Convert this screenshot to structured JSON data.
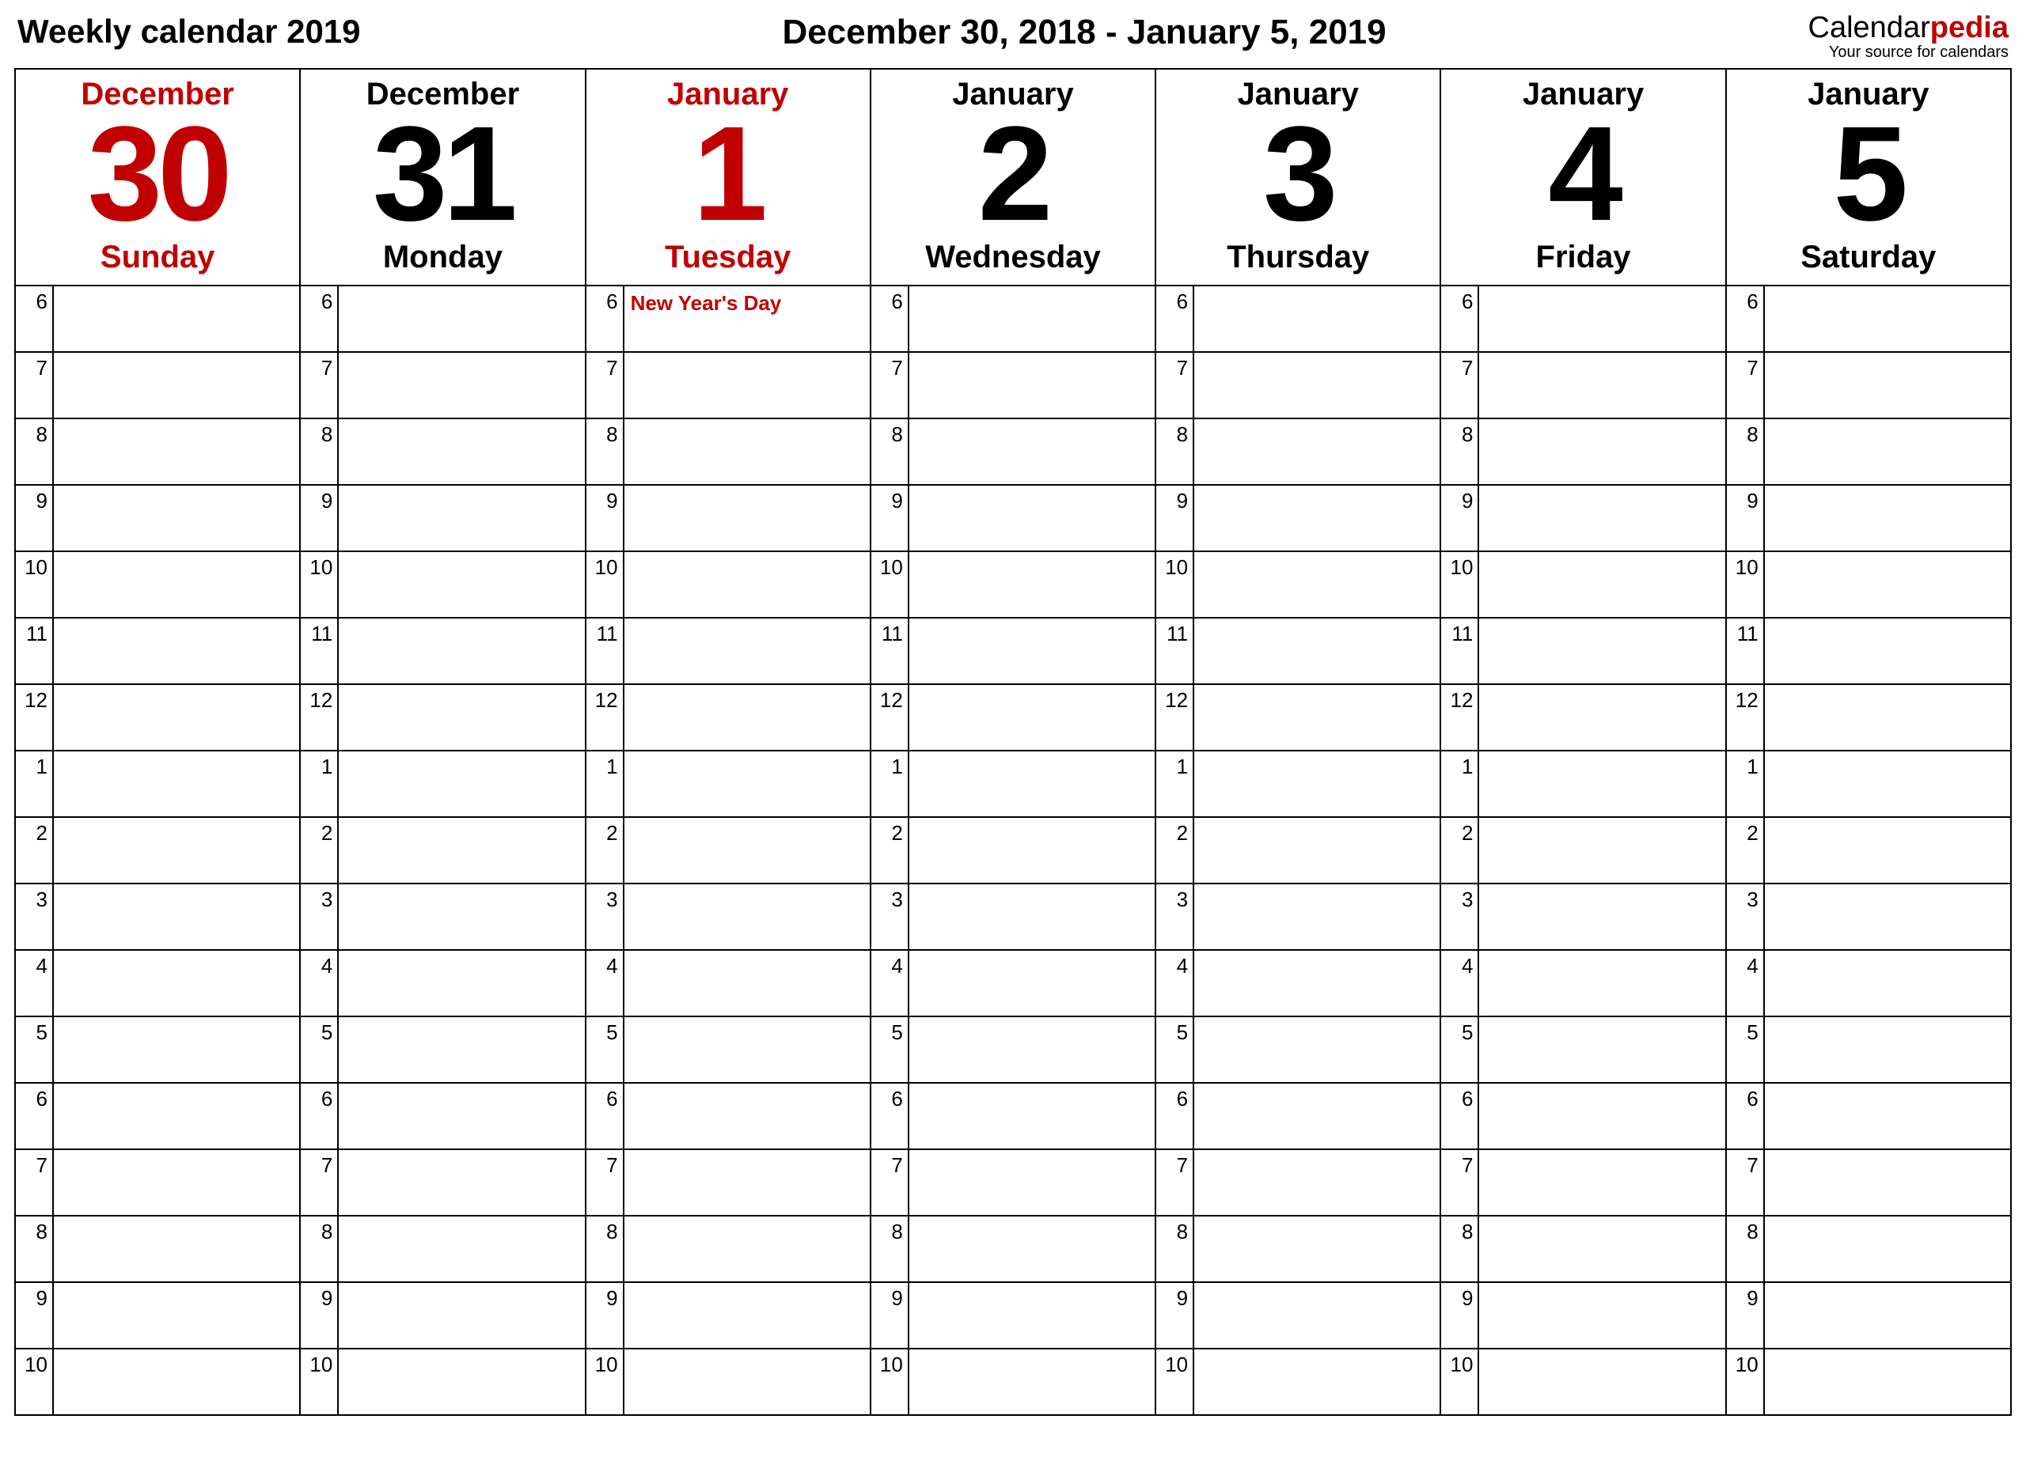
{
  "header": {
    "title_left": "Weekly calendar 2019",
    "title_center": "December 30, 2018 - January 5, 2019",
    "brand_main_a": "Calendar",
    "brand_main_b": "pedia",
    "brand_sub": "Your source for calendars"
  },
  "hours": [
    "6",
    "7",
    "8",
    "9",
    "10",
    "11",
    "12",
    "1",
    "2",
    "3",
    "4",
    "5",
    "6",
    "7",
    "8",
    "9",
    "10"
  ],
  "days": [
    {
      "month": "December",
      "num": "30",
      "dow": "Sunday",
      "red": true,
      "events": {}
    },
    {
      "month": "December",
      "num": "31",
      "dow": "Monday",
      "red": false,
      "events": {}
    },
    {
      "month": "January",
      "num": "1",
      "dow": "Tuesday",
      "red": true,
      "events": {
        "0": "New Year's Day"
      }
    },
    {
      "month": "January",
      "num": "2",
      "dow": "Wednesday",
      "red": false,
      "events": {}
    },
    {
      "month": "January",
      "num": "3",
      "dow": "Thursday",
      "red": false,
      "events": {}
    },
    {
      "month": "January",
      "num": "4",
      "dow": "Friday",
      "red": false,
      "events": {}
    },
    {
      "month": "January",
      "num": "5",
      "dow": "Saturday",
      "red": false,
      "events": {}
    }
  ]
}
